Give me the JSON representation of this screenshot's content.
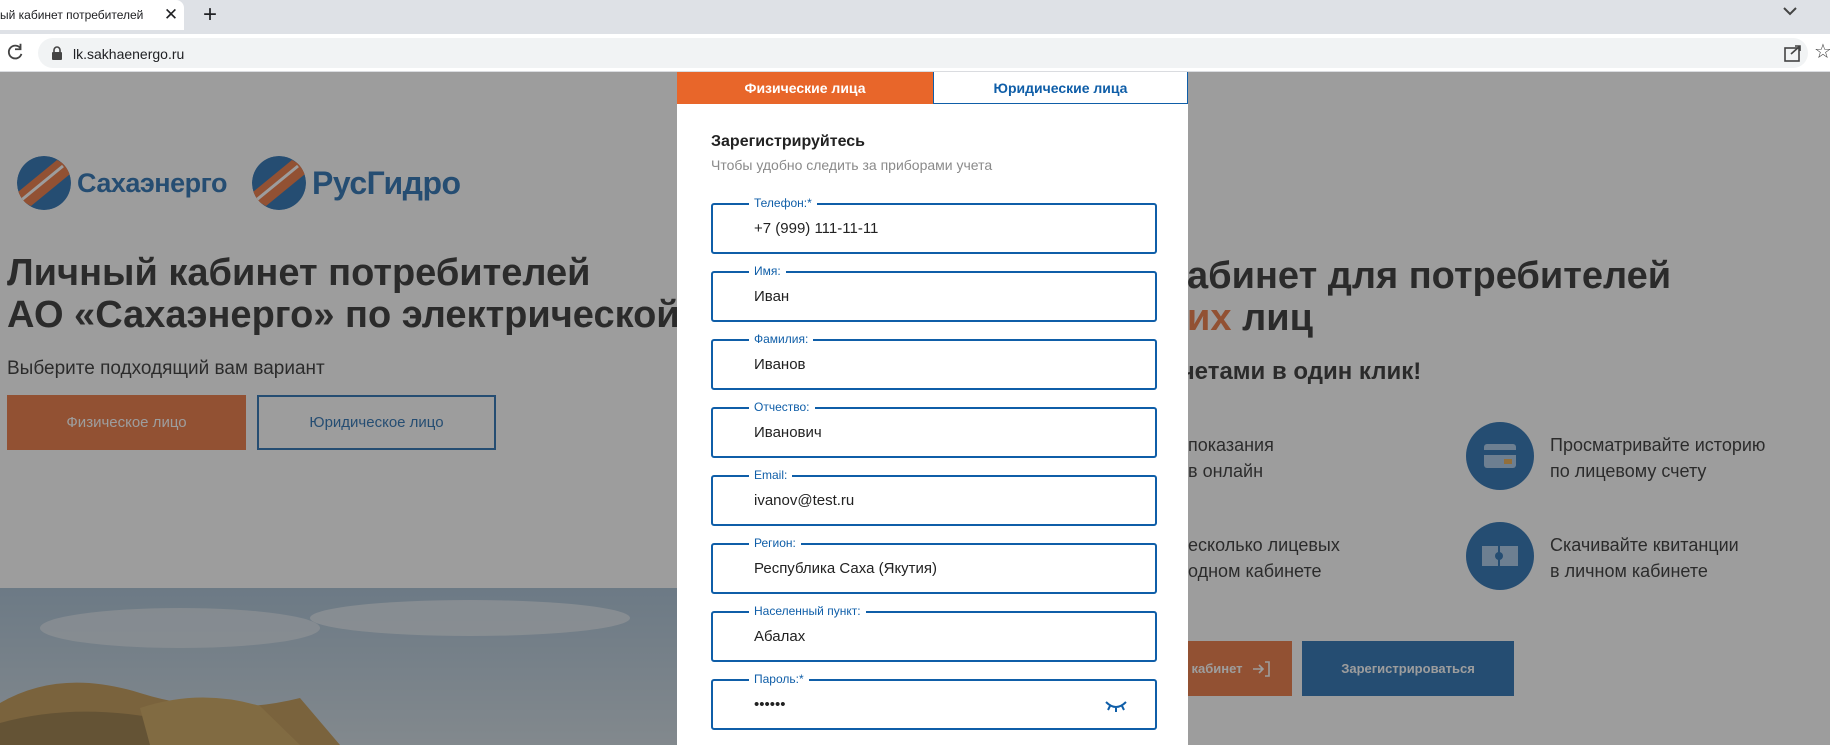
{
  "browser": {
    "tab_title": "ый кабинет потребителей",
    "url": "lk.sakhaenergo.ru",
    "new_tab_symbol": "+"
  },
  "page": {
    "logos": [
      "Сахаэнерго",
      "РусГидро"
    ],
    "heading_left_line1": "Личный кабинет потребителей",
    "heading_left_line2": "АО «Сахаэнерго» по электрической",
    "subtitle_left": "Выберите подходящий вам вариант",
    "btn_individual": "Физическое лицо",
    "btn_legal": "Юридическое лицо",
    "heading_right_line1": "кабинет для потребителей",
    "heading_right_line2_accent": "ких",
    "heading_right_line2_rest": " лиц",
    "subtitle_right": "счетами в один клик!",
    "features": [
      {
        "line1": "показания",
        "line2": "в онлайн"
      },
      {
        "line1": "Просматривайте историю",
        "line2": "по лицевому счету"
      },
      {
        "line1": "есколько лицевых",
        "line2": "одном кабинете"
      },
      {
        "line1": "Скачивайте квитанции",
        "line2": "в личном кабинете"
      }
    ],
    "btn_login": "кабинет",
    "btn_register": "Зарегистрироваться"
  },
  "modal": {
    "tab_individuals": "Физические лица",
    "tab_legal": "Юридические лица",
    "title": "Зарегистрируйтесь",
    "subtitle": "Чтобы удобно следить за приборами учета",
    "fields": [
      {
        "label": "Телефон:*",
        "value": "+7 (999) 111-11-11"
      },
      {
        "label": "Имя:",
        "value": "Иван"
      },
      {
        "label": "Фамилия:",
        "value": "Иванов"
      },
      {
        "label": "Отчество:",
        "value": "Иванович"
      },
      {
        "label": "Email:",
        "value": "ivanov@test.ru"
      },
      {
        "label": "Регион:",
        "value": "Республика Саха (Якутия)"
      },
      {
        "label": "Населенный пункт:",
        "value": "Абалах"
      },
      {
        "label": "Пароль:*",
        "value": "••••••"
      }
    ]
  },
  "colors": {
    "brand_blue": "#0f5ea8",
    "brand_orange": "#e8662a"
  }
}
